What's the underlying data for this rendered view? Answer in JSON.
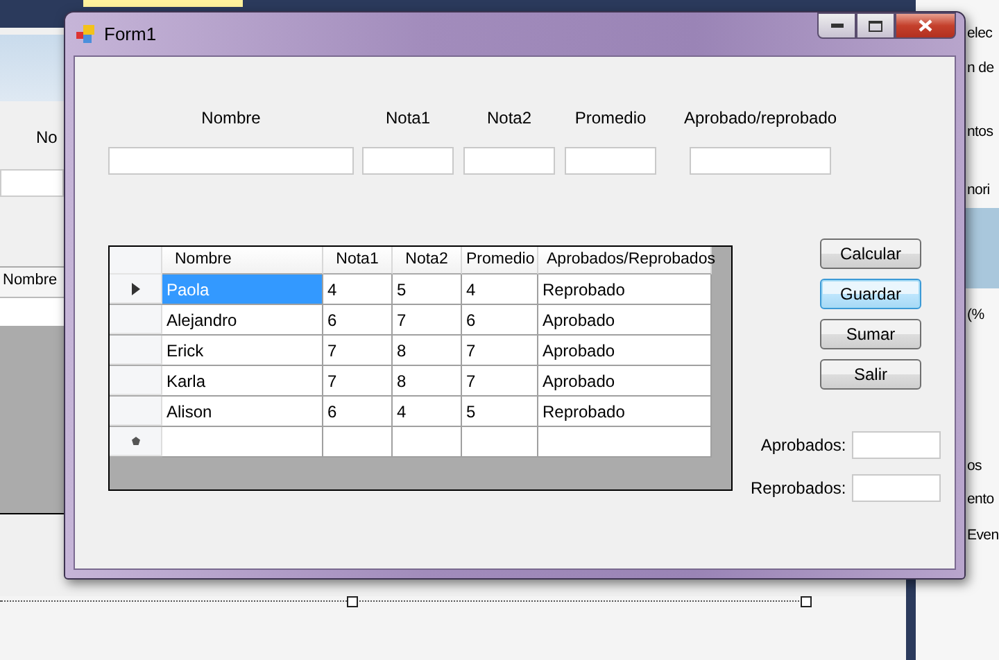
{
  "background": {
    "left_texts": [
      "No"
    ],
    "left_grid_header": "Nombre",
    "panel_texts": [
      "elec",
      "n de",
      "ntos",
      "nori",
      "(%",
      "os",
      "ento",
      "Even"
    ]
  },
  "window": {
    "title": "Form1"
  },
  "fields": [
    {
      "label": "Nombre"
    },
    {
      "label": "Nota1"
    },
    {
      "label": "Nota2"
    },
    {
      "label": "Promedio"
    },
    {
      "label": "Aprobado/reprobado"
    }
  ],
  "table": {
    "columns": [
      "Nombre",
      "Nota1",
      "Nota2",
      "Promedio",
      "Aprobados/Reprobados"
    ],
    "rows": [
      {
        "selected": true,
        "cells": [
          "Paola",
          "4",
          "5",
          "4",
          "Reprobado"
        ]
      },
      {
        "selected": false,
        "cells": [
          "Alejandro",
          "6",
          "7",
          "6",
          "Aprobado"
        ]
      },
      {
        "selected": false,
        "cells": [
          "Erick",
          "7",
          "8",
          "7",
          "Aprobado"
        ]
      },
      {
        "selected": false,
        "cells": [
          "Karla",
          "7",
          "8",
          "7",
          "Aprobado"
        ]
      },
      {
        "selected": false,
        "cells": [
          "Alison",
          "6",
          "4",
          "5",
          "Reprobado"
        ]
      }
    ]
  },
  "buttons": [
    {
      "label": "Calcular",
      "focused": false
    },
    {
      "label": "Guardar",
      "focused": true
    },
    {
      "label": "Sumar",
      "focused": false
    },
    {
      "label": "Salir",
      "focused": false
    }
  ],
  "totals": [
    {
      "label": "Aprobados:"
    },
    {
      "label": "Reprobados:"
    }
  ]
}
